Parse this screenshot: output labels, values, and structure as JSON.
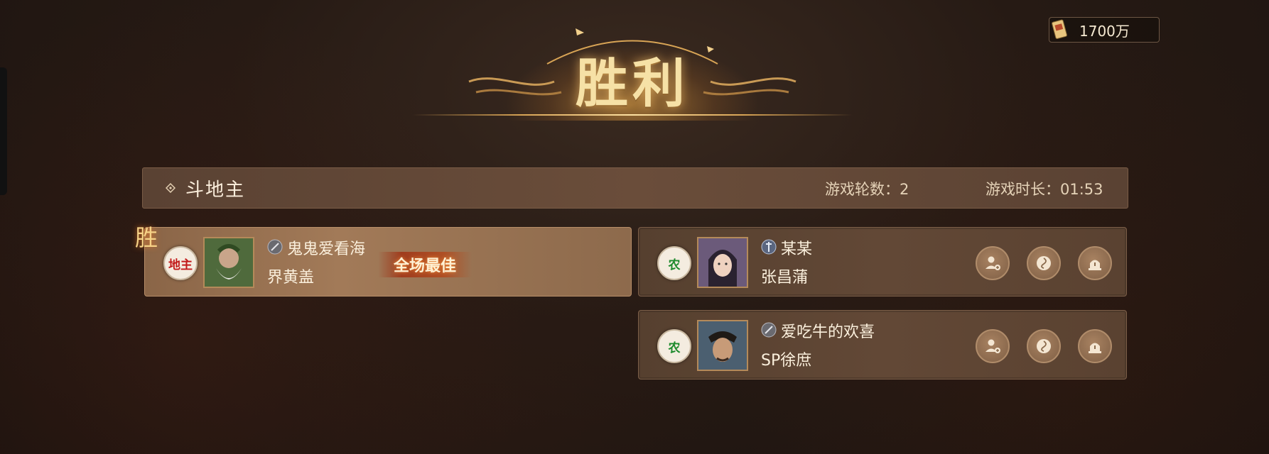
{
  "title": "胜利",
  "currency": {
    "amount": "1700万",
    "icon": "scroll-icon"
  },
  "header": {
    "mode": "斗地主",
    "rounds_label": "游戏轮数：2",
    "duration_label": "游戏时长：01:53"
  },
  "winner_mark": "胜",
  "players": [
    {
      "role": "地主",
      "role_short": "地主",
      "player_name": "鬼鬼爱看海",
      "hero_name": "界黄盖",
      "badge": "全场最佳",
      "portrait_icon": "hero-portrait"
    },
    {
      "role": "农",
      "role_short": "农",
      "player_name": "某某",
      "hero_name": "张昌蒲",
      "portrait_icon": "hero-portrait"
    },
    {
      "role": "农",
      "role_short": "农",
      "player_name": "爱吃牛的欢喜",
      "hero_name": "SP徐庶",
      "portrait_icon": "hero-portrait"
    }
  ],
  "colors": {
    "landlord": "#c21a1a",
    "farmer": "#1d8a2c",
    "gold": "#f6e1a6"
  }
}
